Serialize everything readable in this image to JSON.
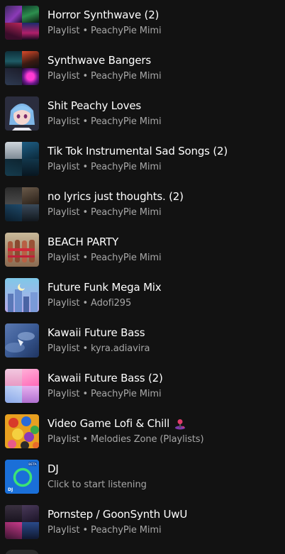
{
  "items": [
    {
      "title": "Horror Synthwave (2)",
      "type": "Playlist",
      "owner": "PeachyPie Mimi",
      "icon": "playlist-cover-mosaic"
    },
    {
      "title": "Synthwave Bangers",
      "type": "Playlist",
      "owner": "PeachyPie Mimi",
      "icon": "playlist-cover-mosaic"
    },
    {
      "title": "Shit Peachy Loves",
      "type": "Playlist",
      "owner": "PeachyPie Mimi",
      "icon": "playlist-cover-anime"
    },
    {
      "title": "Tik Tok Instrumental Sad Songs (2)",
      "type": "Playlist",
      "owner": "PeachyPie Mimi",
      "icon": "playlist-cover-mosaic"
    },
    {
      "title": "no lyrics just thoughts. (2)",
      "type": "Playlist",
      "owner": "PeachyPie Mimi",
      "icon": "playlist-cover-mosaic"
    },
    {
      "title": "BEACH PARTY",
      "type": "Playlist",
      "owner": "PeachyPie Mimi",
      "icon": "playlist-cover-photo"
    },
    {
      "title": "Future Funk Mega Mix",
      "type": "Playlist",
      "owner": "Adofi295",
      "icon": "playlist-cover-art"
    },
    {
      "title": "Kawaii Future Bass",
      "type": "Playlist",
      "owner": "kyra.adiavira",
      "icon": "playlist-cover-art"
    },
    {
      "title": "Kawaii Future Bass (2)",
      "type": "Playlist",
      "owner": "PeachyPie Mimi",
      "icon": "playlist-cover-mosaic"
    },
    {
      "title": "Video Game Lofi & Chill",
      "type": "Playlist",
      "owner": "Melodies Zone (Playlists)",
      "icon": "playlist-cover-art",
      "emoji": "joystick-icon"
    },
    {
      "title": "DJ",
      "subtitle": "Click to start listening",
      "icon": "dj-icon",
      "badge": "BETA",
      "badge_label": "DJ"
    },
    {
      "title": "Pornstep / GoonSynth UwU",
      "type": "Playlist",
      "owner": "PeachyPie Mimi",
      "icon": "playlist-cover-mosaic"
    }
  ],
  "separator": " • ",
  "colors": {
    "background": "#121212",
    "title": "#ffffff",
    "subtitle": "#a7a7a7",
    "dj_blue": "#1a6fd8",
    "dj_green": "#3be477"
  }
}
